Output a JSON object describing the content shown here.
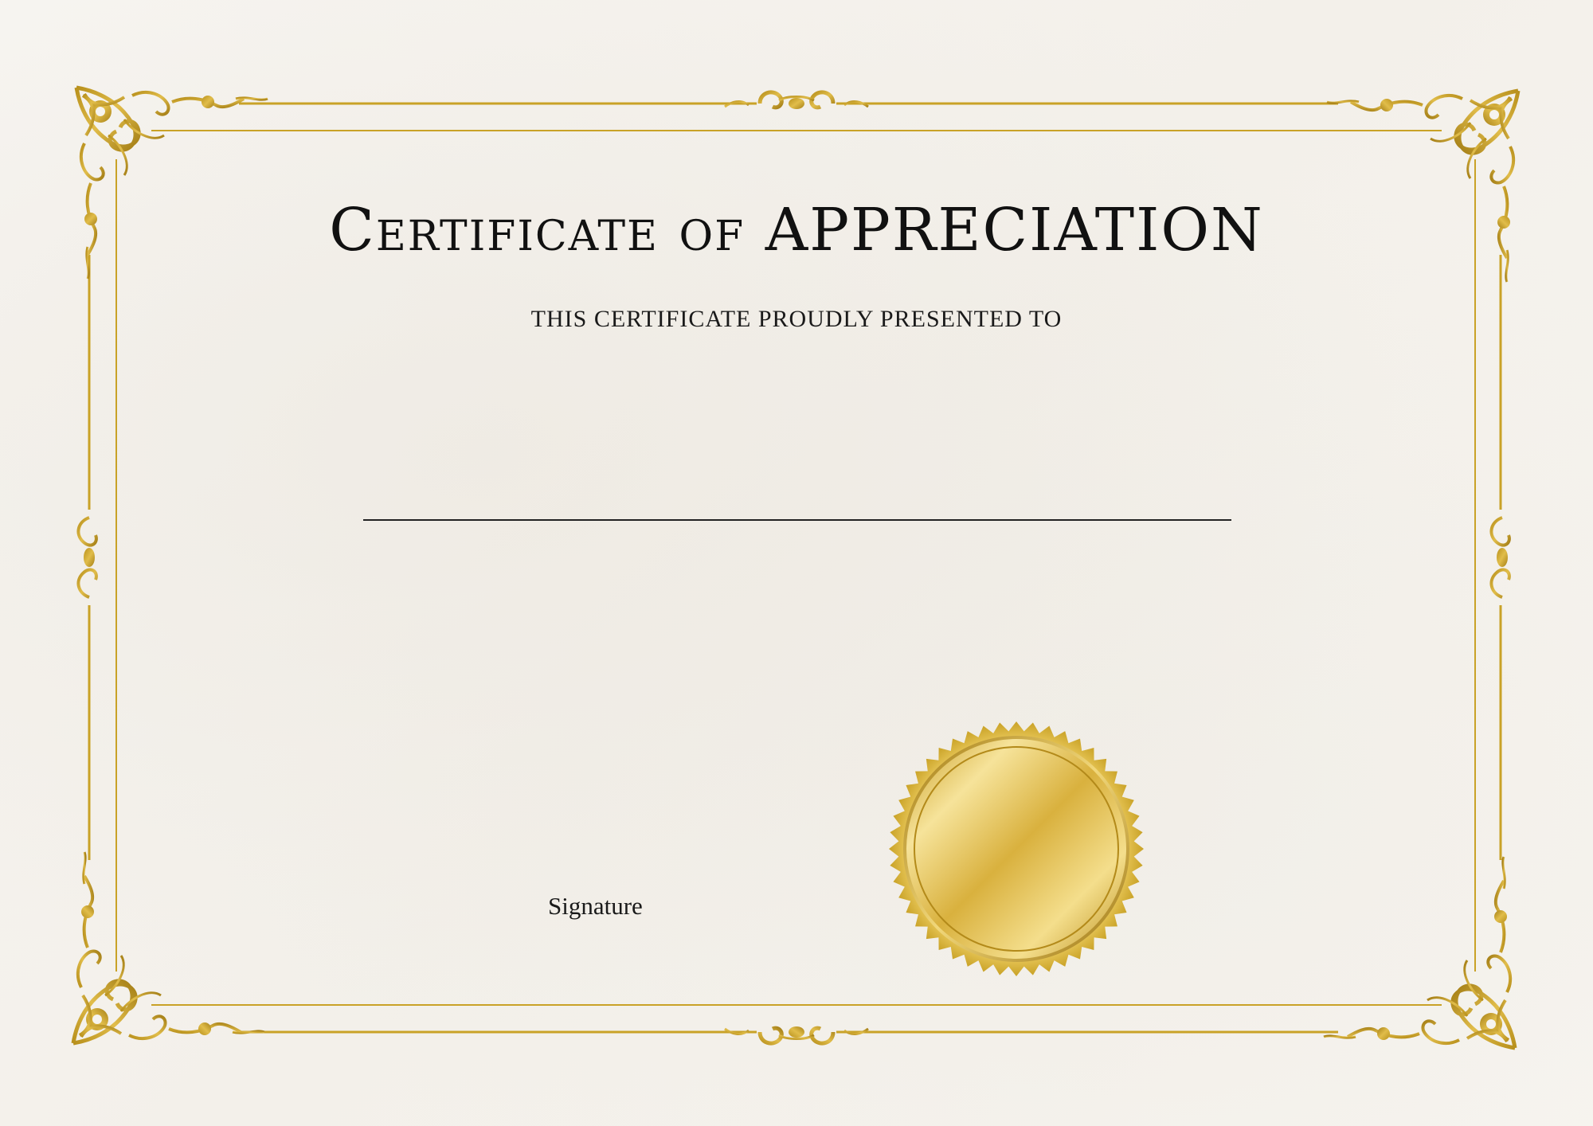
{
  "certificate": {
    "title": "Certificate of APPRECIATION",
    "subtitle": "THIS CERTIFICATE PROUDLY PRESENTED TO",
    "signature_label": "Signature"
  },
  "colors": {
    "gold": "#c9a227",
    "gold_dark": "#a8841a",
    "text": "#111111",
    "paper": "#f6f4ef"
  },
  "icons": {
    "corner": "ornamental-corner-flourish",
    "center": "ornamental-scroll-flourish",
    "seal": "gold-seal"
  }
}
